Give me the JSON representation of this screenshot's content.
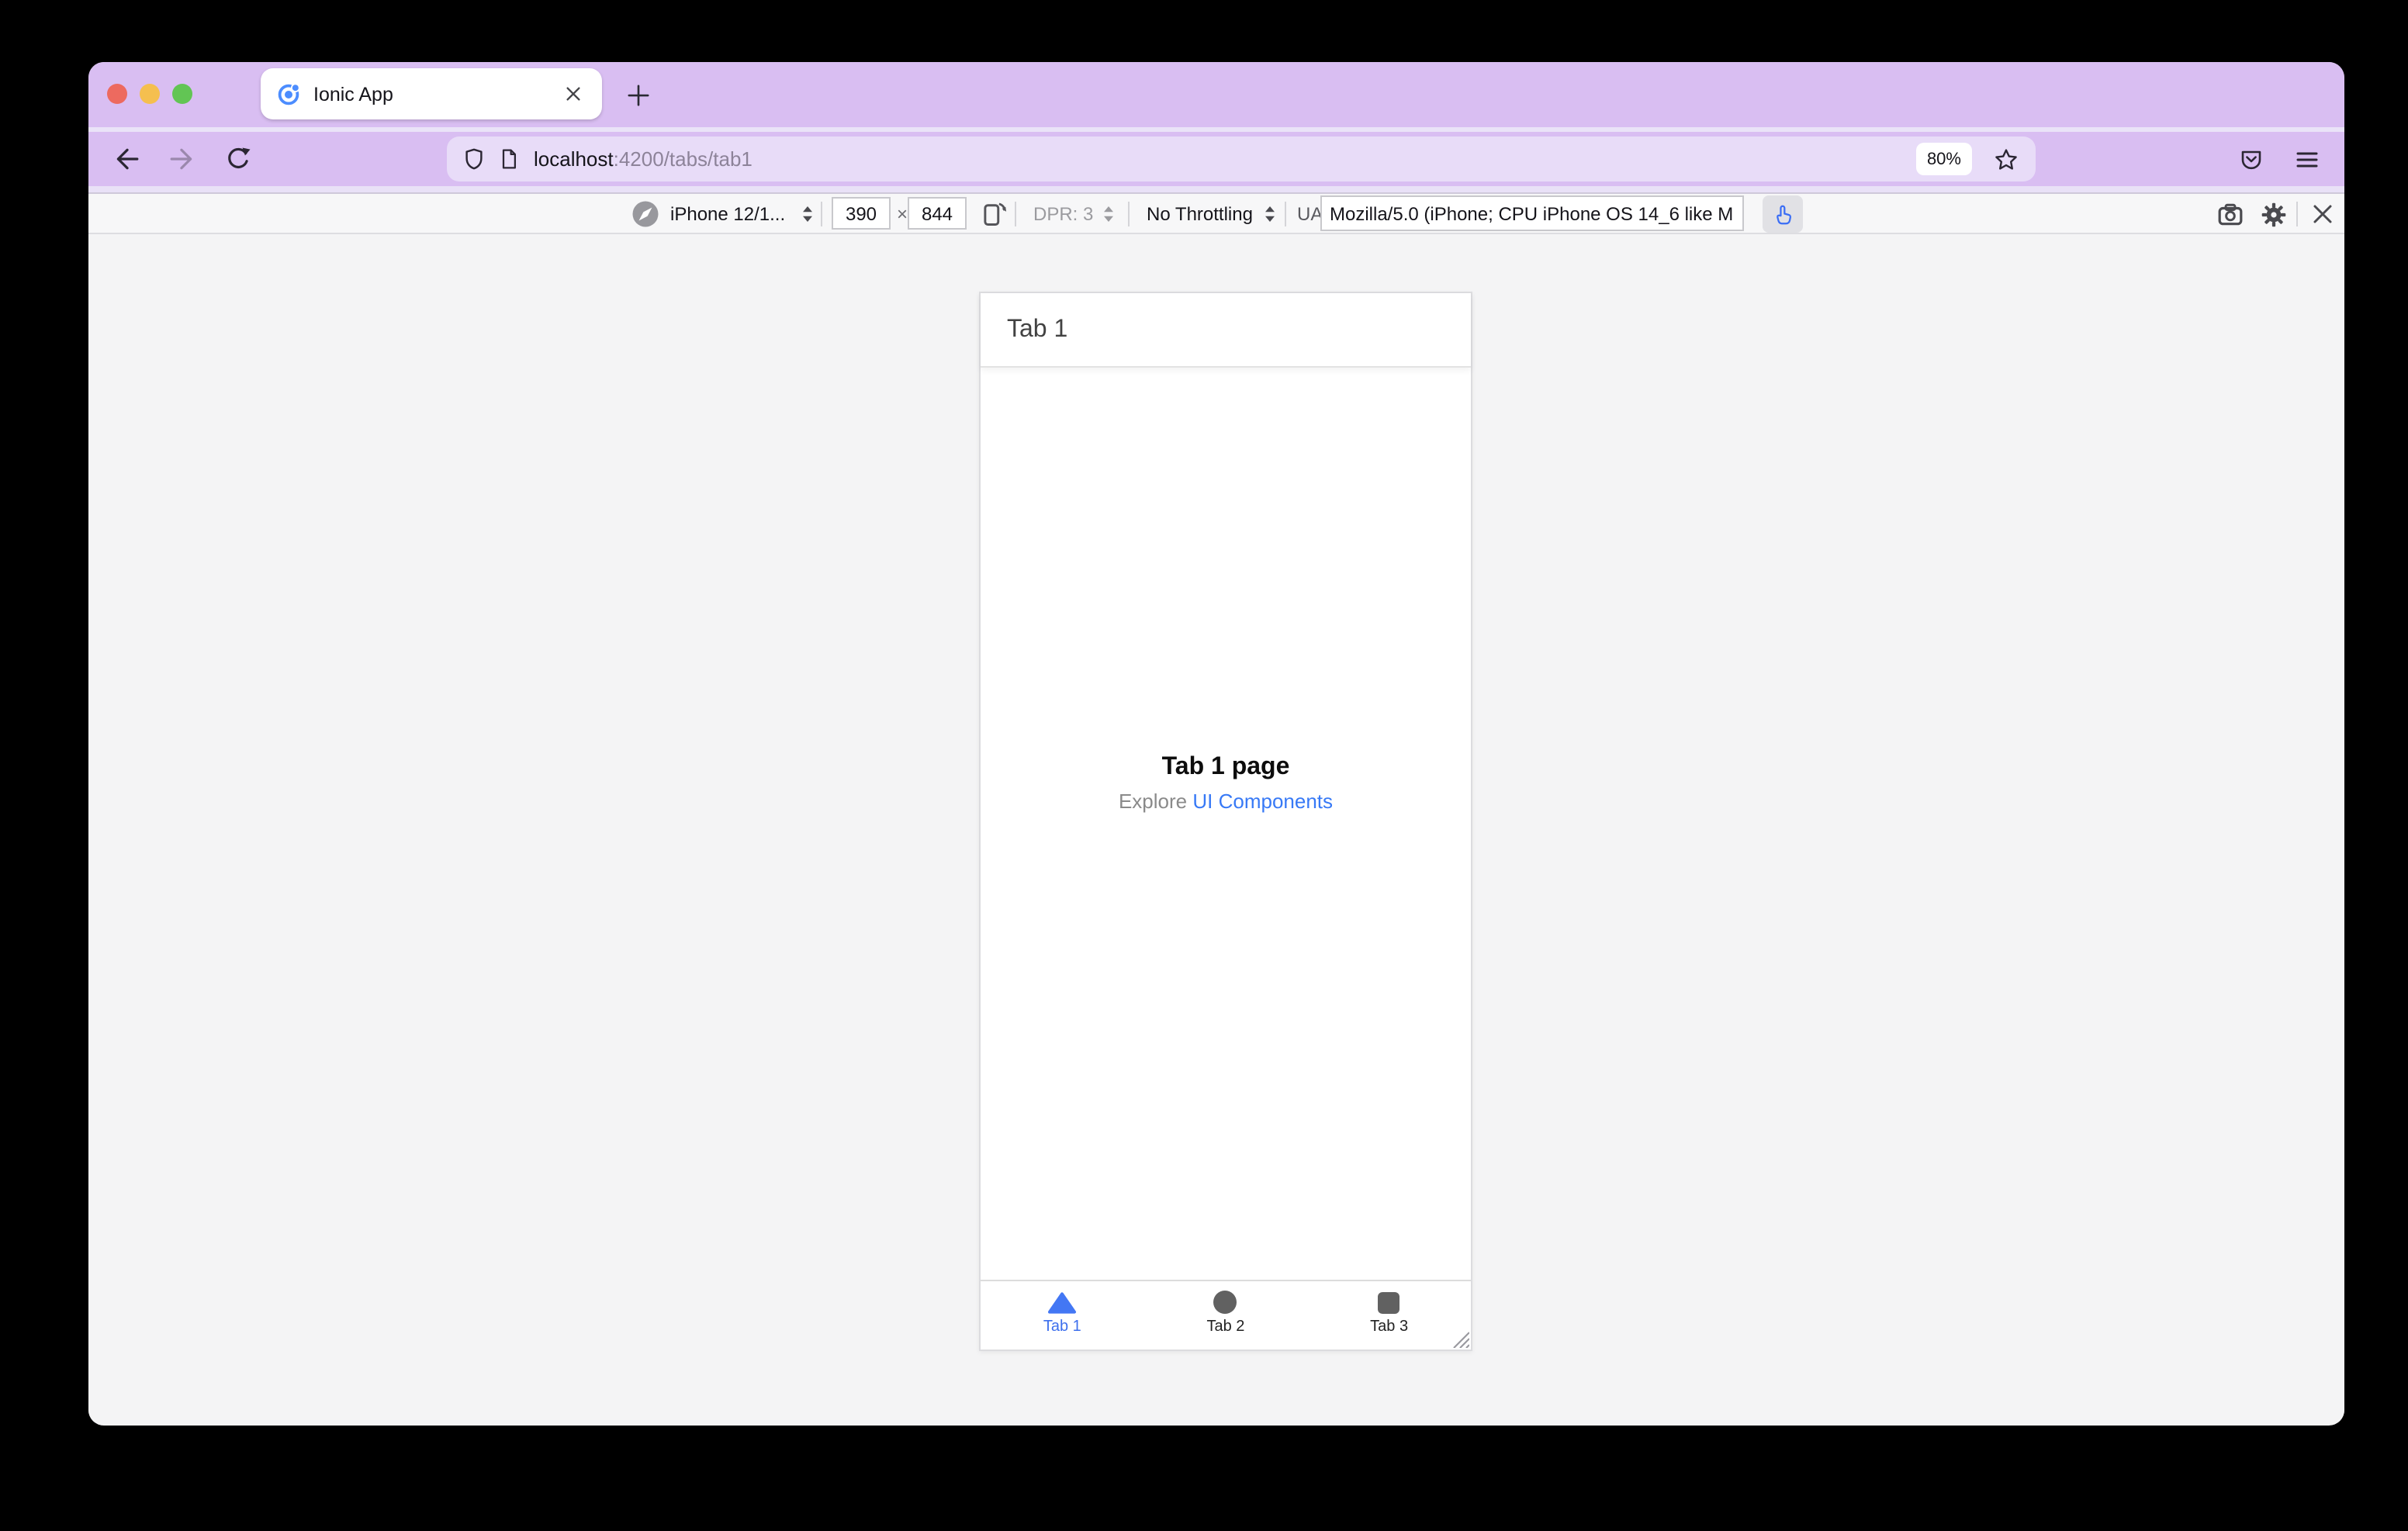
{
  "browser": {
    "tab_title": "Ionic App",
    "url_host": "localhost",
    "url_rest": ":4200/tabs/tab1",
    "zoom_badge": "80%"
  },
  "rdm_toolbar": {
    "device": "iPhone 12/1...",
    "viewport_width": "390",
    "times": "×",
    "viewport_height": "844",
    "dpr": "DPR: 3",
    "throttling": "No Throttling",
    "ua_label": "UA:",
    "ua_value": "Mozilla/5.0 (iPhone; CPU iPhone OS 14_6 like M"
  },
  "phone": {
    "header_title": "Tab 1",
    "page_title": "Tab 1 page",
    "explore_prefix": "Explore ",
    "explore_link": "UI Components",
    "tabs": [
      {
        "label": "Tab 1",
        "icon": "triangle",
        "active": true
      },
      {
        "label": "Tab 2",
        "icon": "circle",
        "active": false
      },
      {
        "label": "Tab 3",
        "icon": "square",
        "active": false
      }
    ]
  },
  "icons": {
    "favicon": "ionic-logo",
    "nav": [
      "back-arrow",
      "forward-arrow",
      "reload"
    ],
    "urlbar": [
      "shield",
      "document",
      "star"
    ],
    "toolbar_right": [
      "pocket",
      "hamburger-menu"
    ],
    "rdm": [
      "safari-compass",
      "stepper-arrows",
      "rotate-viewport",
      "touch-pointer",
      "camera",
      "gear",
      "close-x"
    ],
    "phone_tabs": [
      "triangle",
      "circle",
      "square"
    ],
    "resize_handle": "diagonal-grip"
  },
  "colors": {
    "theme_purple": "#d9bef2",
    "url_field_purple": "#e8dcf8",
    "accent_blue": "#3d6fed",
    "link_blue": "#3779f6",
    "tab_icon_gray": "#616161",
    "toolbar_bg": "#f7f7f8",
    "page_bg": "#f4f4f5"
  }
}
